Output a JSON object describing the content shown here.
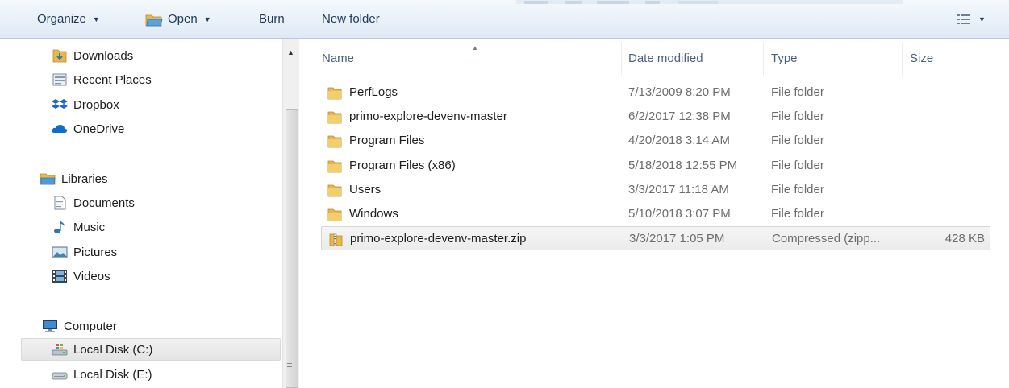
{
  "toolbar": {
    "organize_label": "Organize",
    "open_label": "Open",
    "burn_label": "Burn",
    "new_folder_label": "New folder"
  },
  "nav": {
    "items": [
      {
        "label": "Downloads",
        "icon": "downloads-folder-icon"
      },
      {
        "label": "Recent Places",
        "icon": "recent-places-icon"
      },
      {
        "label": "Dropbox",
        "icon": "dropbox-icon"
      },
      {
        "label": "OneDrive",
        "icon": "onedrive-cloud-icon"
      },
      {
        "label": "Libraries",
        "icon": "libraries-icon"
      },
      {
        "label": "Documents",
        "icon": "documents-icon"
      },
      {
        "label": "Music",
        "icon": "music-note-icon"
      },
      {
        "label": "Pictures",
        "icon": "pictures-icon"
      },
      {
        "label": "Videos",
        "icon": "videos-film-icon"
      },
      {
        "label": "Computer",
        "icon": "computer-monitor-icon"
      },
      {
        "label": "Local Disk (C:)",
        "icon": "system-drive-icon",
        "selected": true
      },
      {
        "label": "Local Disk (E:)",
        "icon": "hard-drive-icon"
      }
    ]
  },
  "columns": {
    "name": "Name",
    "date": "Date modified",
    "type": "Type",
    "size": "Size"
  },
  "files": [
    {
      "name": "PerfLogs",
      "date": "7/13/2009 8:20 PM",
      "type": "File folder",
      "size": "",
      "icon": "folder-icon"
    },
    {
      "name": "primo-explore-devenv-master",
      "date": "6/2/2017 12:38 PM",
      "type": "File folder",
      "size": "",
      "icon": "folder-icon"
    },
    {
      "name": "Program Files",
      "date": "4/20/2018 3:14 AM",
      "type": "File folder",
      "size": "",
      "icon": "folder-icon"
    },
    {
      "name": "Program Files (x86)",
      "date": "5/18/2018 12:55 PM",
      "type": "File folder",
      "size": "",
      "icon": "folder-icon"
    },
    {
      "name": "Users",
      "date": "3/3/2017 11:18 AM",
      "type": "File folder",
      "size": "",
      "icon": "folder-icon"
    },
    {
      "name": "Windows",
      "date": "5/10/2018 3:07 PM",
      "type": "File folder",
      "size": "",
      "icon": "folder-icon"
    },
    {
      "name": "primo-explore-devenv-master.zip",
      "date": "3/3/2017 1:05 PM",
      "type": "Compressed (zipp...",
      "size": "428 KB",
      "icon": "zip-archive-icon",
      "selected": true
    }
  ],
  "colors": {
    "toolbar_text": "#1e395b",
    "header_text": "#4c607a",
    "detail_text": "#6d6d6d",
    "folder_yellow": "#e8b84a"
  }
}
